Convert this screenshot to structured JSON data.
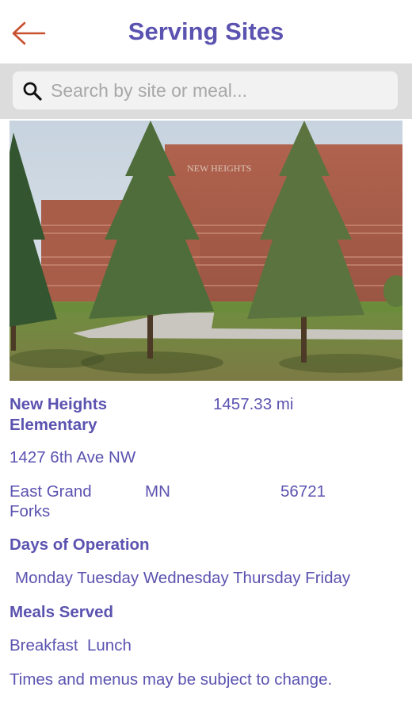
{
  "header": {
    "title": "Serving Sites",
    "back_icon": "arrow-left-icon",
    "back_color": "#c8502f",
    "title_color": "#5b53b0"
  },
  "search": {
    "placeholder": "Search by site or meal...",
    "value": "",
    "icon": "search-icon"
  },
  "site": {
    "name_line1": "New Heights",
    "name_line2": "Elementary",
    "distance": "1457.33 mi",
    "address": "1427 6th Ave NW",
    "city_line1": "East Grand",
    "city_line2": "Forks",
    "state": "MN",
    "zip": "56721",
    "days_heading": "Days of Operation",
    "days": "Monday Tuesday Wednesday Thursday Friday",
    "meals_heading": "Meals Served",
    "meals": "Breakfast  Lunch",
    "note": "Times and menus may be subject to change.",
    "photo_sign": "NEW HEIGHTS"
  }
}
